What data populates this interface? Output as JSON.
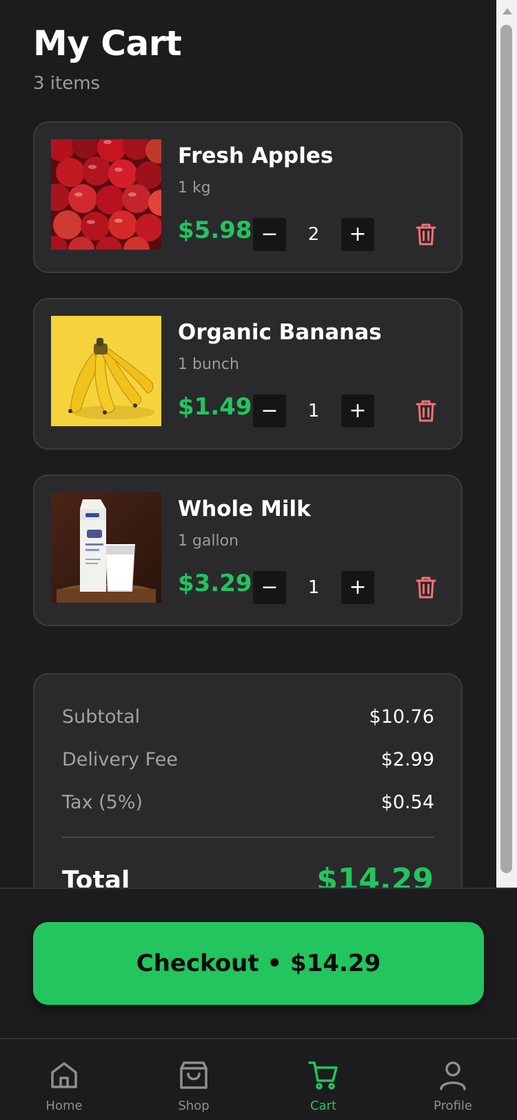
{
  "header": {
    "title": "My Cart",
    "count": "3 items"
  },
  "items": [
    {
      "name": "Fresh Apples",
      "unit": "1 kg",
      "price": "$5.98",
      "qty": "2"
    },
    {
      "name": "Organic Bananas",
      "unit": "1 bunch",
      "price": "$1.49",
      "qty": "1"
    },
    {
      "name": "Whole Milk",
      "unit": "1 gallon",
      "price": "$3.29",
      "qty": "1"
    }
  ],
  "controls": {
    "minus": "−",
    "plus": "+"
  },
  "summary": {
    "subtotal_label": "Subtotal",
    "subtotal": "$10.76",
    "delivery_label": "Delivery Fee",
    "delivery": "$2.99",
    "tax_label": "Tax (5%)",
    "tax": "$0.54",
    "total_label": "Total",
    "total": "$14.29"
  },
  "checkout": {
    "label": "Checkout • $14.29"
  },
  "tabs": [
    {
      "label": "Home",
      "icon": "home-icon"
    },
    {
      "label": "Shop",
      "icon": "shopping-bag-icon"
    },
    {
      "label": "Cart",
      "icon": "cart-icon",
      "active": true
    },
    {
      "label": "Profile",
      "icon": "user-icon"
    }
  ],
  "colors": {
    "accent": "#22c55e",
    "danger": "#f87171",
    "background": "#1c1c1e",
    "card": "#2a2a2d"
  }
}
